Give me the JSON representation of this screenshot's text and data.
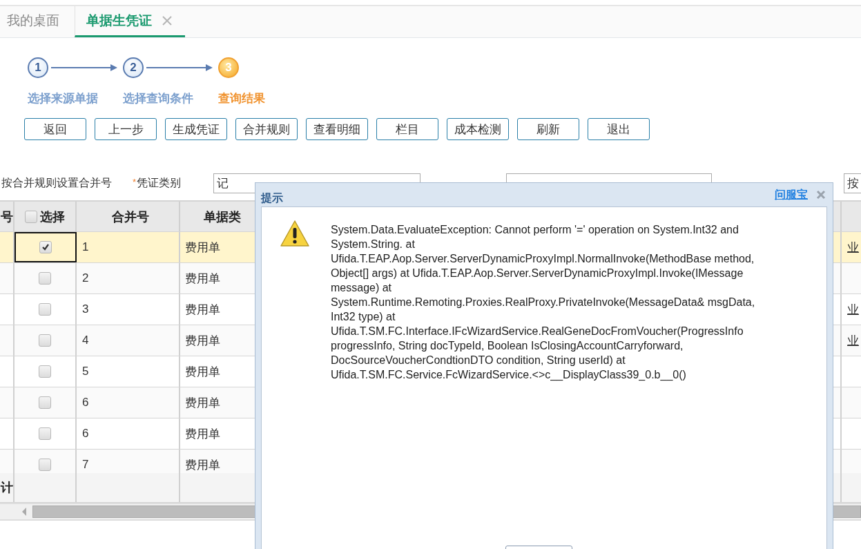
{
  "tabs": [
    {
      "label": "我的桌面",
      "selected": false,
      "closable": false
    },
    {
      "label": "单据生凭证",
      "selected": true,
      "closable": true
    }
  ],
  "steps": [
    {
      "number": "1",
      "label": "选择来源单据",
      "selected": false
    },
    {
      "number": "2",
      "label": "选择查询条件",
      "selected": false
    },
    {
      "number": "3",
      "label": "查询结果",
      "selected": true
    }
  ],
  "buttons": [
    "返回",
    "上一步",
    "生成凭证",
    "合并规则",
    "查看明细",
    "栏目",
    "成本检测",
    "刷新",
    "退出"
  ],
  "filter": {
    "merge_label": "按合并规则设置合并号",
    "required_mark": "*",
    "voucher_type_label": "凭证类别",
    "voucher_type_value": "记",
    "right_field_value": "按"
  },
  "table": {
    "columns": [
      "号",
      "选择",
      "合并号",
      "单据类"
    ],
    "select_all_checked": false,
    "rows": [
      {
        "selected": true,
        "checked": true,
        "merge_no": "1",
        "doc_type": "费用单",
        "link": "业"
      },
      {
        "selected": false,
        "checked": false,
        "merge_no": "2",
        "doc_type": "费用单"
      },
      {
        "selected": false,
        "checked": false,
        "merge_no": "3",
        "doc_type": "费用单",
        "link": "业"
      },
      {
        "selected": false,
        "checked": false,
        "merge_no": "4",
        "doc_type": "费用单",
        "link": "业"
      },
      {
        "selected": false,
        "checked": false,
        "merge_no": "5",
        "doc_type": "费用单"
      },
      {
        "selected": false,
        "checked": false,
        "merge_no": "6",
        "doc_type": "费用单"
      },
      {
        "selected": false,
        "checked": false,
        "merge_no": "6",
        "doc_type": "费用单"
      },
      {
        "selected": false,
        "checked": false,
        "merge_no": "7",
        "doc_type": "费用单"
      }
    ],
    "total_label": "计"
  },
  "dialog": {
    "title": "提示",
    "link": "问服宝",
    "message_lines": [
      "System.Data.EvaluateException: Cannot perform '=' operation on System.Int32 and",
      "System.String. at",
      "Ufida.T.EAP.Aop.Server.ServerDynamicProxyImpl.NormalInvoke(MethodBase method,",
      "Object[] args) at Ufida.T.EAP.Aop.Server.ServerDynamicProxyImpl.Invoke(IMessage",
      "message) at",
      "System.Runtime.Remoting.Proxies.RealProxy.PrivateInvoke(MessageData& msgData,",
      "Int32 type) at",
      "Ufida.T.SM.FC.Interface.IFcWizardService.RealGeneDocFromVoucher(ProgressInfo",
      "progressInfo, String docTypeId, Boolean IsClosingAccountCarryforward,",
      "DocSourceVoucherCondtionDTO condition, String userId) at",
      "Ufida.T.SM.FC.Service.FcWizardService.<>c__DisplayClass39_0.b__0()"
    ]
  }
}
